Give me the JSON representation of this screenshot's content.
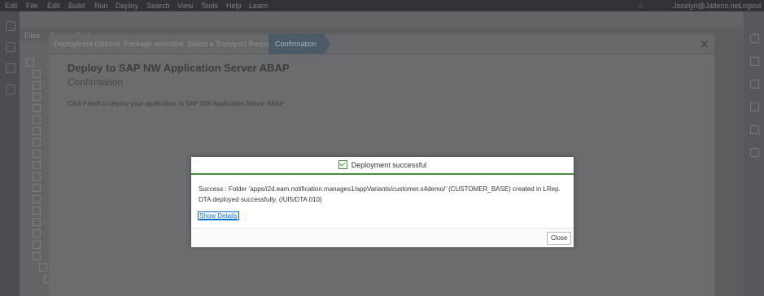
{
  "menubar": {
    "items": [
      "Edit",
      "File",
      "Edit",
      "Build",
      "Run",
      "Deploy",
      "Search",
      "View",
      "Tools",
      "Help",
      "Learn"
    ],
    "user": "Jocelyn@Jatlens.net",
    "logout": "Logout"
  },
  "workspace": {
    "tabs": [
      "Files",
      "Search Explorer"
    ]
  },
  "wizard": {
    "steps": [
      "Deployment Options",
      "Package selection",
      "Select a Transport Request"
    ],
    "active_step": "Confirmation",
    "title": "Deploy to SAP NW Application Server ABAP",
    "subtitle": "Confirmation",
    "instruction": "Click Finish to deploy your application to SAP NW Application Server ABAP"
  },
  "dialog": {
    "title": "Deployment successful",
    "message": "Success : Folder 'apps/i2d.eam.notification.manages1/appVariants/customer.s4demo/' (CUSTOMER_BASE) created in LRep. DTA deployed successfully. (/UI5/DTA 010)",
    "show_details": "Show Details",
    "close": "Close",
    "accent_color": "#4a8a3c"
  }
}
